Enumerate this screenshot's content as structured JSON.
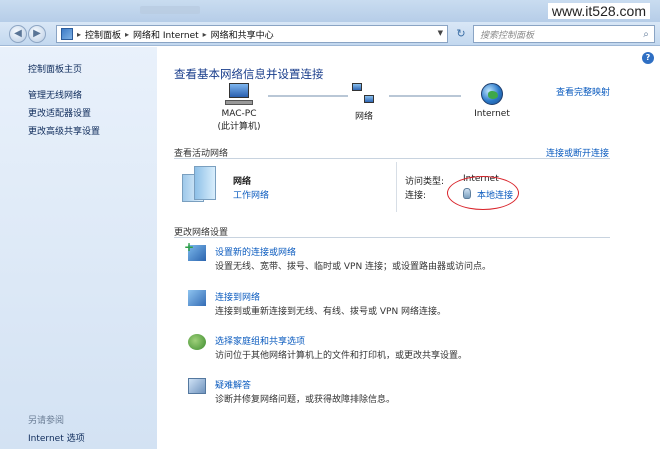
{
  "window": {
    "watermark": "www.it528.com"
  },
  "nav": {
    "breadcrumbs": [
      "控制面板",
      "网络和 Internet",
      "网络和共享中心"
    ],
    "search_placeholder": "搜索控制面板"
  },
  "sidebar": {
    "items": [
      {
        "label": "控制面板主页"
      },
      {
        "label": "管理无线网络"
      },
      {
        "label": "更改适配器设置"
      },
      {
        "label": "更改高级共享设置"
      }
    ],
    "see_also_title": "另请参阅",
    "see_also_items": [
      {
        "label": "Internet 选项"
      }
    ]
  },
  "main": {
    "title": "查看基本网络信息并设置连接",
    "full_map_link": "查看完整映射",
    "map_nodes": [
      {
        "line1": "MAC-PC",
        "line2": "(此计算机)",
        "icon": "computer-icon"
      },
      {
        "line1": "网络",
        "line2": "",
        "icon": "network-icon"
      },
      {
        "line1": "Internet",
        "line2": "",
        "icon": "globe-icon"
      }
    ],
    "active_networks_label": "查看活动网络",
    "connect_disconnect_link": "连接或断开连接",
    "network": {
      "name": "网络",
      "type": "工作网络",
      "access_type_label": "访问类型:",
      "access_type_value": "Internet",
      "connection_label": "连接:",
      "connection_value": "本地连接"
    },
    "change_settings_label": "更改网络设置",
    "tasks": [
      {
        "link": "设置新的连接或网络",
        "desc": "设置无线、宽带、拨号、临时或 VPN 连接；或设置路由器或访问点。"
      },
      {
        "link": "连接到网络",
        "desc": "连接到或重新连接到无线、有线、拨号或 VPN 网络连接。"
      },
      {
        "link": "选择家庭组和共享选项",
        "desc": "访问位于其他网络计算机上的文件和打印机，或更改共享设置。"
      },
      {
        "link": "疑难解答",
        "desc": "诊断并修复网络问题，或获得故障排除信息。"
      }
    ]
  },
  "colors": {
    "link": "#0b5bbf",
    "title": "#1a3e8c",
    "highlight_ellipse": "#d9242b"
  }
}
